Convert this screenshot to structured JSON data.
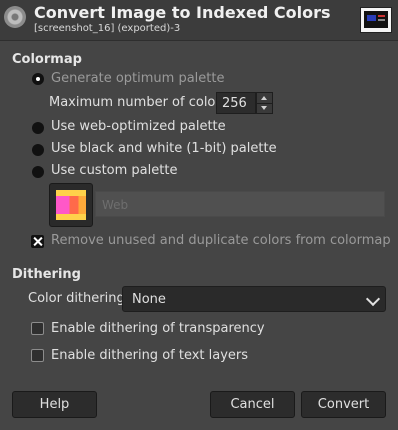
{
  "header": {
    "title": "Convert Image to Indexed Colors",
    "subtitle": "[screenshot_16] (exported)-3",
    "icon": "gimp-wilber-icon",
    "thumbnail": "image-thumbnail"
  },
  "colormap": {
    "section_label": "Colormap",
    "optimum_palette_label": "Generate optimum palette",
    "max_colors_label": "Maximum number of colors:",
    "max_colors_value": "256",
    "web_palette_label": "Use web-optimized palette",
    "bw_palette_label": "Use black and white (1-bit) palette",
    "custom_palette_label": "Use custom palette",
    "custom_palette_name": "Web",
    "remove_unused_label": "Remove unused and duplicate colors from colormap",
    "remove_unused_checked": true,
    "selected_option": "Generate optimum palette"
  },
  "dithering": {
    "section_label": "Dithering",
    "color_dithering_label": "Color dithering:",
    "color_dithering_value": "None",
    "transparency_label": "Enable dithering of transparency",
    "text_layers_label": "Enable dithering of text layers",
    "transparency_checked": false,
    "text_layers_checked": false
  },
  "buttons": {
    "help": "Help",
    "cancel": "Cancel",
    "convert": "Convert"
  }
}
